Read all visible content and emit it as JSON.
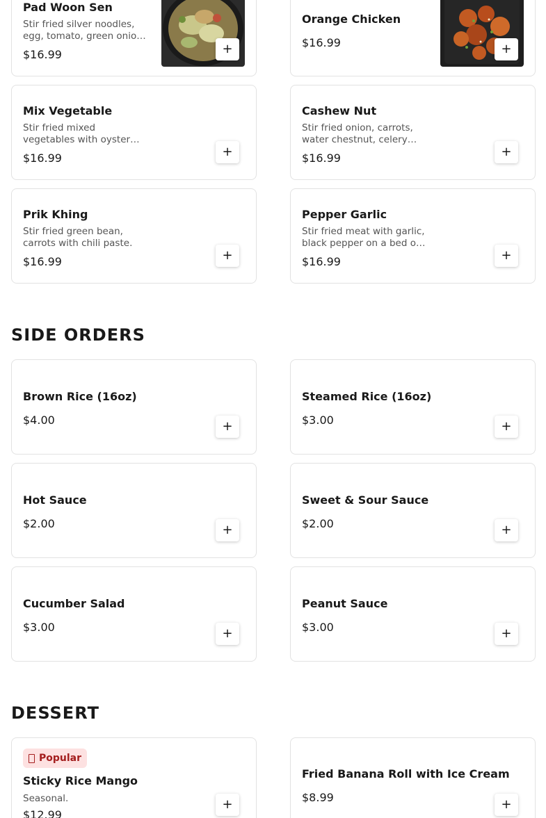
{
  "sections": {
    "sides_title": "SIDE ORDERS",
    "dessert_title": "DESSERT"
  },
  "items": {
    "pad_woon_sen": {
      "name": "Pad Woon Sen",
      "desc": "Stir fried silver noodles, egg, tomato, green onion, cabbage and celery.",
      "price": "$16.99"
    },
    "orange_chicken": {
      "name": "Orange Chicken",
      "price": "$16.99"
    },
    "mix_vegetable": {
      "name": "Mix Vegetable",
      "desc": "Stir fried mixed vegetables with oyster sauce.",
      "price": "$16.99"
    },
    "cashew_nut": {
      "name": "Cashew Nut",
      "desc": "Stir fried onion, carrots, water chestnut, celery and cashew nut.",
      "price": "$16.99"
    },
    "prik_khing": {
      "name": "Prik Khing",
      "desc": "Stir fried green bean, carrots with chili paste.",
      "price": "$16.99"
    },
    "pepper_garlic": {
      "name": "Pepper Garlic",
      "desc": "Stir fried meat with garlic, black pepper on a bed of steamed vegetables.",
      "price": "$16.99"
    },
    "brown_rice": {
      "name": "Brown Rice (16oz)",
      "price": "$4.00"
    },
    "steamed_rice": {
      "name": "Steamed Rice (16oz)",
      "price": "$3.00"
    },
    "hot_sauce": {
      "name": "Hot Sauce",
      "price": "$2.00"
    },
    "sweet_sour_sauce": {
      "name": "Sweet & Sour Sauce",
      "price": "$2.00"
    },
    "cucumber_salad": {
      "name": "Cucumber Salad",
      "price": "$3.00"
    },
    "peanut_sauce": {
      "name": "Peanut Sauce",
      "price": "$3.00"
    },
    "sticky_rice_mango": {
      "badge": "Popular",
      "name": "Sticky Rice Mango",
      "desc": "Seasonal.",
      "price": "$12.99"
    },
    "fried_banana_roll": {
      "name": "Fried Banana Roll with Ice Cream",
      "price": "$8.99"
    }
  },
  "add_label": "+",
  "colors": {
    "badge_bg": "#fde1e1",
    "badge_text": "#a41e1e",
    "card_border": "#e2e2e2"
  },
  "icons": {
    "add": "plus-icon",
    "badge": "popular-icon"
  }
}
